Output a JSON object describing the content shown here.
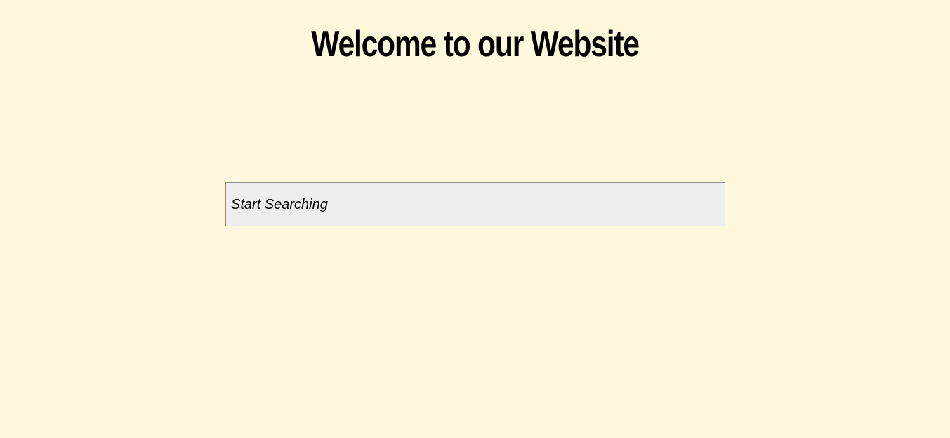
{
  "header": {
    "title": "Welcome to our Website"
  },
  "search": {
    "value": "",
    "placeholder": "Start Searching"
  },
  "colors": {
    "background": "#FFF8DC",
    "input_background": "#EEEEEE",
    "input_border": "#8E8E8E",
    "text": "#000000"
  }
}
